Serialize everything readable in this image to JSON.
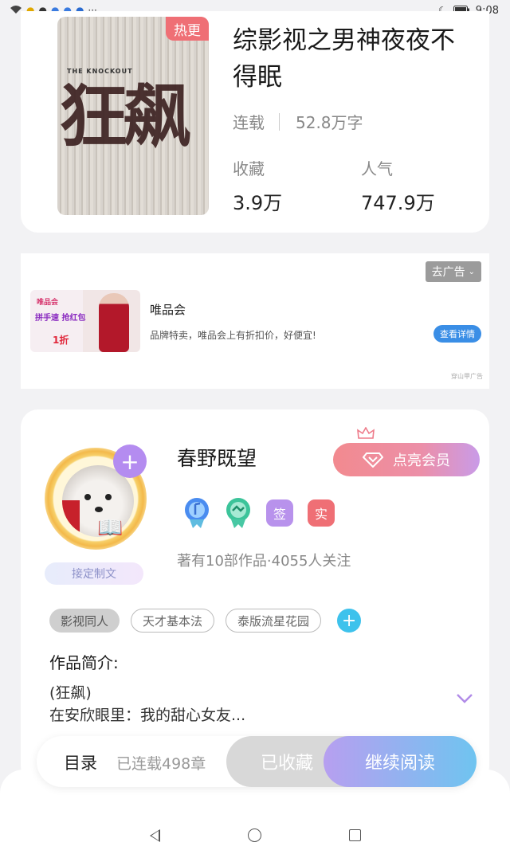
{
  "status_bar": {
    "time": "9:08"
  },
  "book": {
    "badge": "热更",
    "cover_title": "狂飙",
    "cover_subtitle": "THE KNOCKOUT",
    "title": "综影视之男神夜夜不得眠",
    "status": "连载",
    "word_count": "52.8万字",
    "favorites_label": "收藏",
    "favorites_value": "3.9万",
    "popularity_label": "人气",
    "popularity_value": "747.9万"
  },
  "ad": {
    "close_label": "去广告",
    "title": "唯品会",
    "description": "品牌特卖，唯品会上有折扣价，好便宜!",
    "cta": "查看详情",
    "footer": "穿山甲广告",
    "image_texts": {
      "brand": "唯品会",
      "promo": "拼手速 抢红包",
      "discount": "1折"
    }
  },
  "author": {
    "name": "春野既望",
    "vip_label": "点亮会员",
    "custom_tag": "接定制文",
    "badges": [
      "签",
      "实"
    ],
    "stats": "著有10部作品·4055人关注",
    "tags": [
      "影视同人",
      "天才基本法",
      "泰版流星花园"
    ]
  },
  "intro": {
    "heading": "作品简介:",
    "line1": "(狂飙)",
    "line2": "在安欣眼里：我的甜心女友..."
  },
  "bottom_bar": {
    "toc_label": "目录",
    "chapter_count": "已连载498章",
    "collected_label": "已收藏",
    "read_label": "继续阅读"
  },
  "colors": {
    "hot": "#ef6f75",
    "accent_blue": "#3ec2ec",
    "vip_pink": "#f28a8f"
  }
}
